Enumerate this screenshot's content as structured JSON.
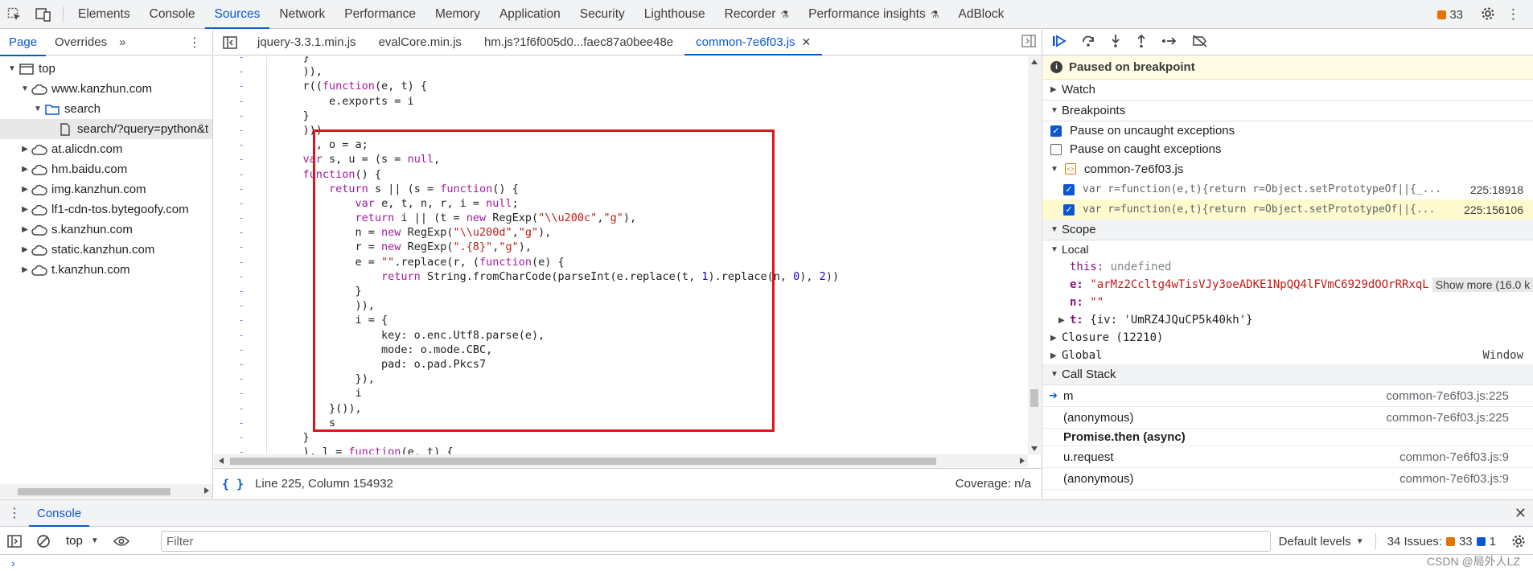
{
  "main_tabs": [
    {
      "label": "Elements",
      "active": false
    },
    {
      "label": "Console",
      "active": false
    },
    {
      "label": "Sources",
      "active": true
    },
    {
      "label": "Network",
      "active": false
    },
    {
      "label": "Performance",
      "active": false
    },
    {
      "label": "Memory",
      "active": false
    },
    {
      "label": "Application",
      "active": false
    },
    {
      "label": "Security",
      "active": false
    },
    {
      "label": "Lighthouse",
      "active": false
    },
    {
      "label": "Recorder",
      "active": false,
      "experimental": true
    },
    {
      "label": "Performance insights",
      "active": false,
      "experimental": true
    },
    {
      "label": "AdBlock",
      "active": false
    }
  ],
  "issues_count": "33",
  "navigator": {
    "tabs": [
      "Page",
      "Overrides"
    ],
    "tree": [
      {
        "label": "top",
        "depth": 0,
        "expanded": true,
        "icon": "frame-icon"
      },
      {
        "label": "www.kanzhun.com",
        "depth": 1,
        "expanded": true,
        "icon": "cloud-icon"
      },
      {
        "label": "search",
        "depth": 2,
        "expanded": true,
        "icon": "folder-icon"
      },
      {
        "label": "search/?query=python&t",
        "depth": 3,
        "expanded": null,
        "icon": "file-icon",
        "selected": true
      },
      {
        "label": "at.alicdn.com",
        "depth": 1,
        "expanded": false,
        "icon": "cloud-icon"
      },
      {
        "label": "hm.baidu.com",
        "depth": 1,
        "expanded": false,
        "icon": "cloud-icon"
      },
      {
        "label": "img.kanzhun.com",
        "depth": 1,
        "expanded": false,
        "icon": "cloud-icon"
      },
      {
        "label": "lf1-cdn-tos.bytegoofy.com",
        "depth": 1,
        "expanded": false,
        "icon": "cloud-icon"
      },
      {
        "label": "s.kanzhun.com",
        "depth": 1,
        "expanded": false,
        "icon": "cloud-icon"
      },
      {
        "label": "static.kanzhun.com",
        "depth": 1,
        "expanded": false,
        "icon": "cloud-icon"
      },
      {
        "label": "t.kanzhun.com",
        "depth": 1,
        "expanded": false,
        "icon": "cloud-icon"
      }
    ]
  },
  "editor": {
    "tabs": [
      {
        "label": "jquery-3.3.1.min.js",
        "active": false
      },
      {
        "label": "evalCore.min.js",
        "active": false
      },
      {
        "label": "hm.js?1f6f005d0...faec87a0bee48e",
        "active": false
      },
      {
        "label": "common-7e6f03.js",
        "active": true
      }
    ],
    "line_marker": "-",
    "code_lines": [
      "    }",
      "    )),",
      "    r((function(e, t) {",
      "        e.exports = i",
      "    }",
      "    )))",
      "      , o = a;",
      "    var s, u = (s = null,",
      "    function() {",
      "        return s || (s = function() {",
      "            var e, t, n, r, i = null;",
      "            return i || (t = new RegExp(\"\\\\u200c\",\"g\"),",
      "            n = new RegExp(\"\\\\u200d\",\"g\"),",
      "            r = new RegExp(\".{8}\",\"g\"),",
      "            e = \"\".replace(r, (function(e) {",
      "                return String.fromCharCode(parseInt(e.replace(t, 1).replace(n, 0), 2))",
      "            }",
      "            )),",
      "            i = {",
      "                key: o.enc.Utf8.parse(e),",
      "                mode: o.mode.CBC,",
      "                pad: o.pad.Pkcs7",
      "            }),",
      "            i",
      "        }()),",
      "        s",
      "    }",
      "    ), l = function(e, t) {"
    ],
    "status_position": "Line 225, Column 154932",
    "coverage": "Coverage: n/a"
  },
  "debugger": {
    "paused_text": "Paused on breakpoint",
    "watch_label": "Watch",
    "breakpoints_label": "Breakpoints",
    "pause_uncaught": "Pause on uncaught exceptions",
    "pause_caught": "Pause on caught exceptions",
    "bp_file": "common-7e6f03.js",
    "breakpoints": [
      {
        "code": "var r=function(e,t){return r=Object.setPrototypeOf||{_...",
        "loc": "225:18918",
        "hit": false
      },
      {
        "code": "var r=function(e,t){return r=Object.setPrototypeOf||{...",
        "loc": "225:156106",
        "hit": true
      }
    ],
    "scope_label": "Scope",
    "local_label": "Local",
    "scope_local": {
      "this_key": "this:",
      "this_val": "undefined",
      "e_key": "e:",
      "e_val": "\"arMz2Ccltg4wTisVJy3oeADKE1NpQQ4lFVmC6929dOOrRRxqL",
      "show_more": "Show more (16.0 k",
      "n_key": "n:",
      "n_val": "\"\"",
      "t_key": "t:",
      "t_val": "{iv: 'UmRZ4JQuCP5k40kh'}"
    },
    "closure_label": "Closure (12210)",
    "global_label": "Global",
    "global_val": "Window",
    "callstack_label": "Call Stack",
    "callstack": [
      {
        "fn": "m",
        "loc": "common-7e6f03.js:225",
        "current": true
      },
      {
        "fn": "(anonymous)",
        "loc": "common-7e6f03.js:225",
        "current": false
      }
    ],
    "async_label": "Promise.then (async)",
    "callstack_after": [
      {
        "fn": "u.request",
        "loc": "common-7e6f03.js:9"
      },
      {
        "fn": "(anonymous)",
        "loc": "common-7e6f03.js:9"
      }
    ]
  },
  "drawer": {
    "tab": "Console",
    "context": "top",
    "filter_placeholder": "Filter",
    "levels": "Default levels",
    "issues_text": "34 Issues:",
    "issues_warn": "33",
    "issues_info": "1"
  },
  "watermark": "CSDN @局外人LZ"
}
